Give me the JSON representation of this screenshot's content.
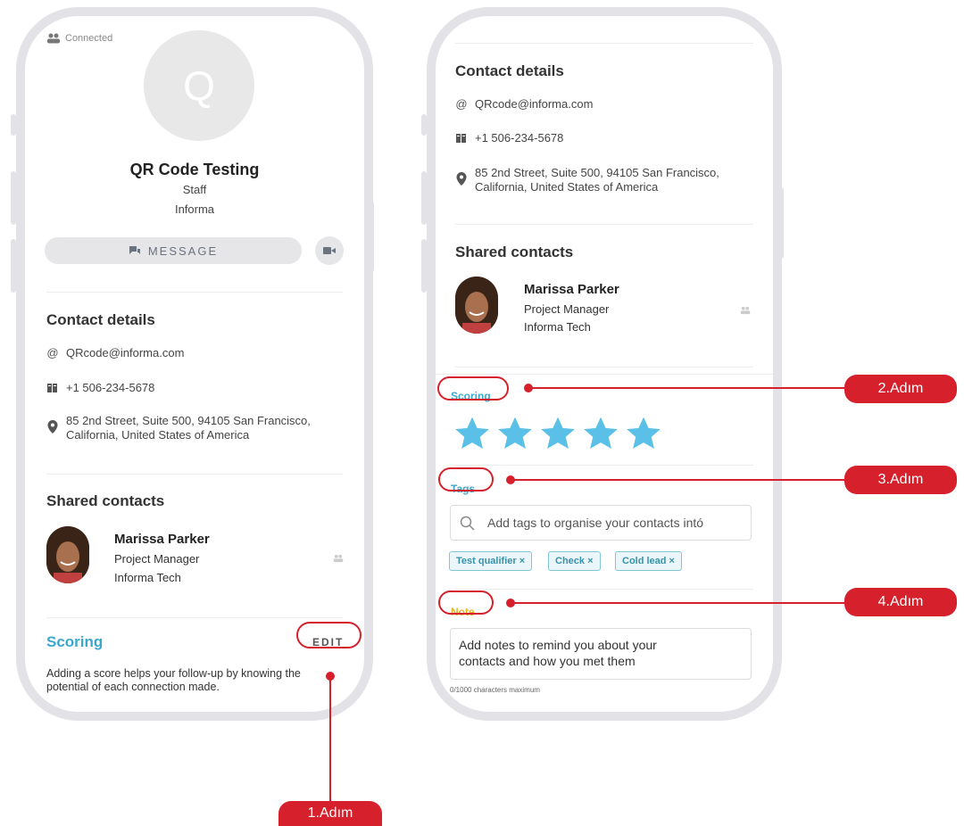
{
  "left_phone": {
    "status_label": "Connected",
    "avatar_letter": "Q",
    "profile": {
      "name": "QR Code Testing",
      "role": "Staff",
      "company": "Informa"
    },
    "message_button": "MESSAGE",
    "contact_details_title": "Contact details",
    "email": "QRcode@informa.com",
    "phone": "+1 506-234-5678",
    "address_line1": "85 2nd Street, Suite 500, 94105 San Francisco,",
    "address_line2": "California, United States of America",
    "shared_contacts_title": "Shared contacts",
    "shared_contact": {
      "name": "Marissa Parker",
      "title": "Project Manager",
      "company": "Informa Tech"
    },
    "scoring_title": "Scoring",
    "edit_button": "EDIT",
    "scoring_desc_line1": "Adding a score helps your follow-up by knowing the",
    "scoring_desc_line2": "potential of each connection made."
  },
  "right_phone": {
    "contact_details_title": "Contact details",
    "email": "QRcode@informa.com",
    "phone": "+1 506-234-5678",
    "address_line1": "85 2nd Street, Suite 500, 94105 San Francisco,",
    "address_line2": "California, United States of America",
    "shared_contacts_title": "Shared contacts",
    "shared_contact": {
      "name": "Marissa Parker",
      "title": "Project Manager",
      "company": "Informa Tech"
    },
    "scoring_label": "Scoring",
    "stars": {
      "value": 5,
      "max": 5,
      "color": "#5bc0e8"
    },
    "tags_label": "Tags",
    "tags_placeholder": "Add tags to organise your contacts intó",
    "tags": [
      "Test qualifier ×",
      "Check ×",
      "Cold lead ×"
    ],
    "note_label": "Note",
    "note_placeholder_line1": "Add notes to remind you about your",
    "note_placeholder_line2": "contacts and how you met them",
    "char_limit": "0/1000 characters maximum"
  },
  "steps": {
    "step1": "1.Adım",
    "step2": "2.Adım",
    "step3": "3.Adım",
    "step4": "4.Adım"
  },
  "colors": {
    "accent_red": "#d6202b",
    "scoring_blue": "#3aa8cc",
    "note_yellow": "#e6b422",
    "star_blue": "#5bc0e8"
  },
  "icons": [
    "people-icon",
    "message-icon",
    "video-icon",
    "at-icon",
    "phone-icon",
    "location-pin-icon",
    "search-icon",
    "star-icon"
  ]
}
